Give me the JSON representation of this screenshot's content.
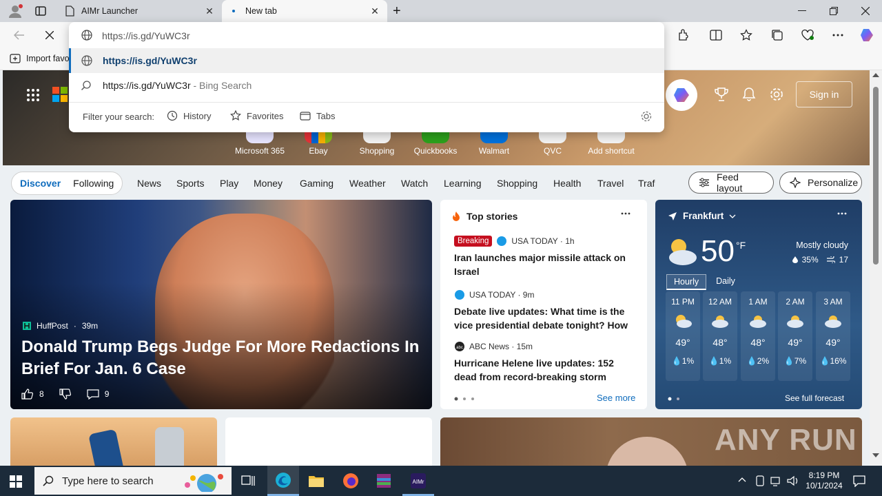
{
  "browser": {
    "tabs": [
      {
        "label": "AIMr Launcher",
        "active": false
      },
      {
        "label": "New tab",
        "active": true
      }
    ],
    "favorites_bar": {
      "import_label": "Import favo"
    }
  },
  "omnibox": {
    "value": "https://is.gd/YuWC3r",
    "suggestions": [
      {
        "text": "https://is.gd/YuWC3r",
        "type": "url"
      },
      {
        "text": "https://is.gd/YuWC3r",
        "suffix": " - Bing Search",
        "type": "search"
      }
    ],
    "filter_label": "Filter your search:",
    "filters": [
      "History",
      "Favorites",
      "Tabs"
    ]
  },
  "header": {
    "sign_in": "Sign in"
  },
  "shortcuts": [
    "Microsoft 365",
    "Ebay",
    "Shopping",
    "Quickbooks",
    "Walmart",
    "QVC",
    "Add shortcut"
  ],
  "nav": {
    "primary": [
      "Discover",
      "Following"
    ],
    "items": [
      "News",
      "Sports",
      "Play",
      "Money",
      "Gaming",
      "Weather",
      "Watch",
      "Learning",
      "Shopping",
      "Health",
      "Travel",
      "Traf"
    ],
    "feed_layout": "Feed layout",
    "personalize": "Personalize"
  },
  "main_story": {
    "source": "HuffPost",
    "age": "39m",
    "headline": "Donald Trump Begs Judge For More Redactions In Brief For Jan. 6 Case",
    "likes": "8",
    "comments": "9"
  },
  "top_stories": {
    "title": "Top stories",
    "see_more": "See more",
    "stories": [
      {
        "badge": "Breaking",
        "source": "USA TODAY · 1h",
        "headline": "Iran launches major missile attack on Israel"
      },
      {
        "source": "USA TODAY · 9m",
        "headline": "Debate live updates: What time is the vice presidential debate tonight? How t..."
      },
      {
        "source": "ABC News · 15m",
        "headline": "Hurricane Helene live updates: 152 dead from record-breaking storm"
      }
    ]
  },
  "weather": {
    "location": "Frankfurt",
    "temp": "50",
    "unit": "°F",
    "condition": "Mostly cloudy",
    "humidity": "35%",
    "wind": "17",
    "tabs": [
      "Hourly",
      "Daily"
    ],
    "hours": [
      {
        "time": "11 PM",
        "temp": "49°",
        "precip": "1%"
      },
      {
        "time": "12 AM",
        "temp": "48°",
        "precip": "1%"
      },
      {
        "time": "1 AM",
        "temp": "48°",
        "precip": "2%"
      },
      {
        "time": "2 AM",
        "temp": "49°",
        "precip": "7%"
      },
      {
        "time": "3 AM",
        "temp": "49°",
        "precip": "16%"
      }
    ],
    "see_full": "See full forecast"
  },
  "watermark": "ANY RUN",
  "taskbar": {
    "search_placeholder": "Type here to search",
    "time": "8:19 PM",
    "date": "10/1/2024"
  }
}
